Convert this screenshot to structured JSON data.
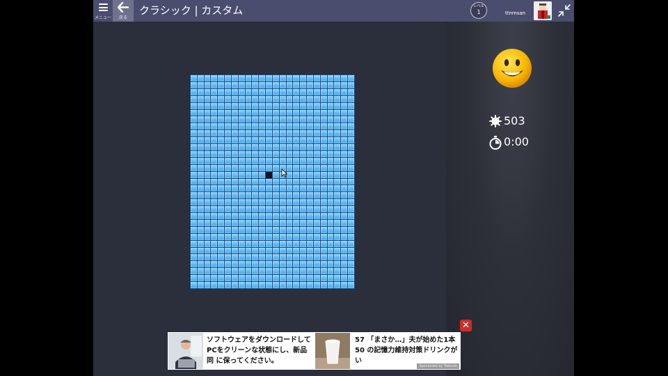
{
  "topbar": {
    "menu_label": "メニュー",
    "back_label": "戻る",
    "title": "クラシック | カスタム",
    "level_label": "レベル",
    "level_value": "1",
    "username": "ttnmsan"
  },
  "board": {
    "columns": 24,
    "rows": 31,
    "opened_cells": [
      {
        "row": 14,
        "col": 11
      }
    ]
  },
  "status": {
    "mines_remaining": "503",
    "timer": "0:00",
    "face": "smiley-face"
  },
  "ad": {
    "item1_text": "ソフトウェアをダウンロードしてPCをクリーンな状態にし、新品同 に保ってください。",
    "item2_text": "57 「まさか…」夫が始めた1本50 の記憶力維持対策ドリンクが い",
    "sponsor": "Sponsored by Taboola",
    "close_label": "✕"
  },
  "colors": {
    "topbar": "#4b4d6e",
    "background": "#2b2e3b",
    "tile": "#5bb8f5",
    "close": "#c9302c"
  }
}
